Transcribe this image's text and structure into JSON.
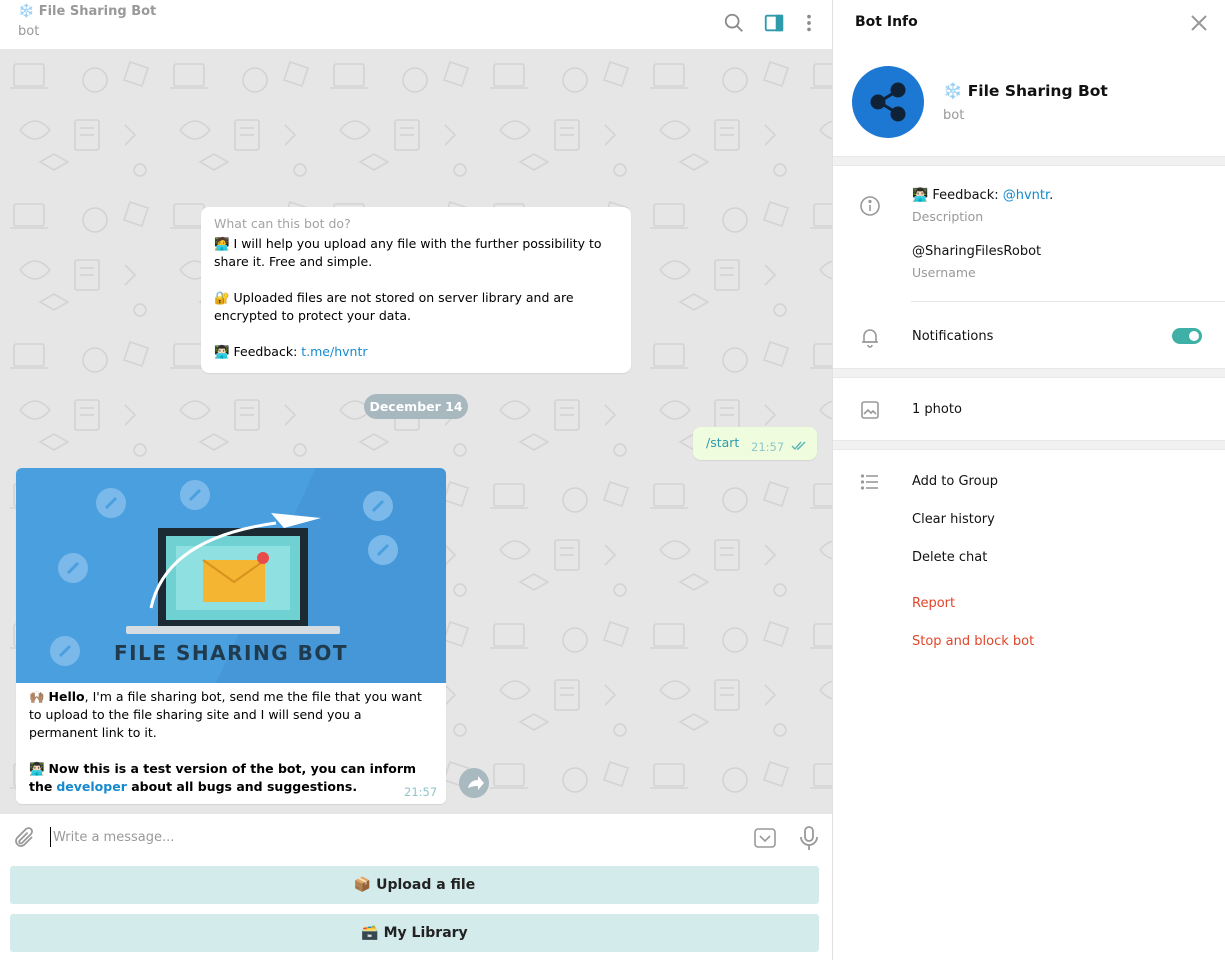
{
  "chat": {
    "header": {
      "title": "❄️ File Sharing Bot",
      "subtitle": "bot"
    },
    "info_card": {
      "title": "What can this bot do?",
      "line1": "🧑‍💻 I will help you upload any file with the further possibility to share it. Free and simple.",
      "line2": "🔐 Uploaded files are not stored on server library and are encrypted to protect your data.",
      "line3_prefix": "👨🏻‍💻 Feedback: ",
      "line3_link": "t.me/hvntr"
    },
    "date_label": "December 14",
    "outgoing": {
      "text": "/start",
      "time": "21:57"
    },
    "incoming": {
      "image_title": "FILE SHARING BOT",
      "hello_emoji": "🙌🏽 ",
      "hello_bold": "Hello",
      "hello_rest": ", I'm a file sharing bot, send me the file that you want to upload to the file sharing site and I will send you a permanent link to it.",
      "note_emoji": "👨🏻‍💻 ",
      "note_bold": "Now this is a test version of the bot, you can inform the",
      "note_link": "developer",
      "note_end": " about all bugs and suggestions.",
      "time": "21:57"
    },
    "composer": {
      "placeholder": "Write a message..."
    },
    "keyboard": [
      {
        "label": "📦 Upload a file"
      },
      {
        "label": "🗃️ My Library"
      }
    ]
  },
  "panel": {
    "title": "Bot Info",
    "bot_name": "❄️ File Sharing Bot",
    "bot_sub": "bot",
    "description_prefix": "👨🏻‍💻 Feedback: ",
    "description_link": "@hvntr",
    "description_end": ".",
    "description_label": "Description",
    "username": "@SharingFilesRobot",
    "username_label": "Username",
    "notifications_label": "Notifications",
    "notifications_on": true,
    "photos_label": "1 photo",
    "actions": [
      "Add to Group",
      "Clear history",
      "Delete chat"
    ],
    "danger_actions": [
      "Report",
      "Stop and block bot"
    ]
  },
  "colors": {
    "accent": "#3fb0a7",
    "link": "#168acd",
    "danger": "#e0462a",
    "button": "#d4ebeb"
  }
}
